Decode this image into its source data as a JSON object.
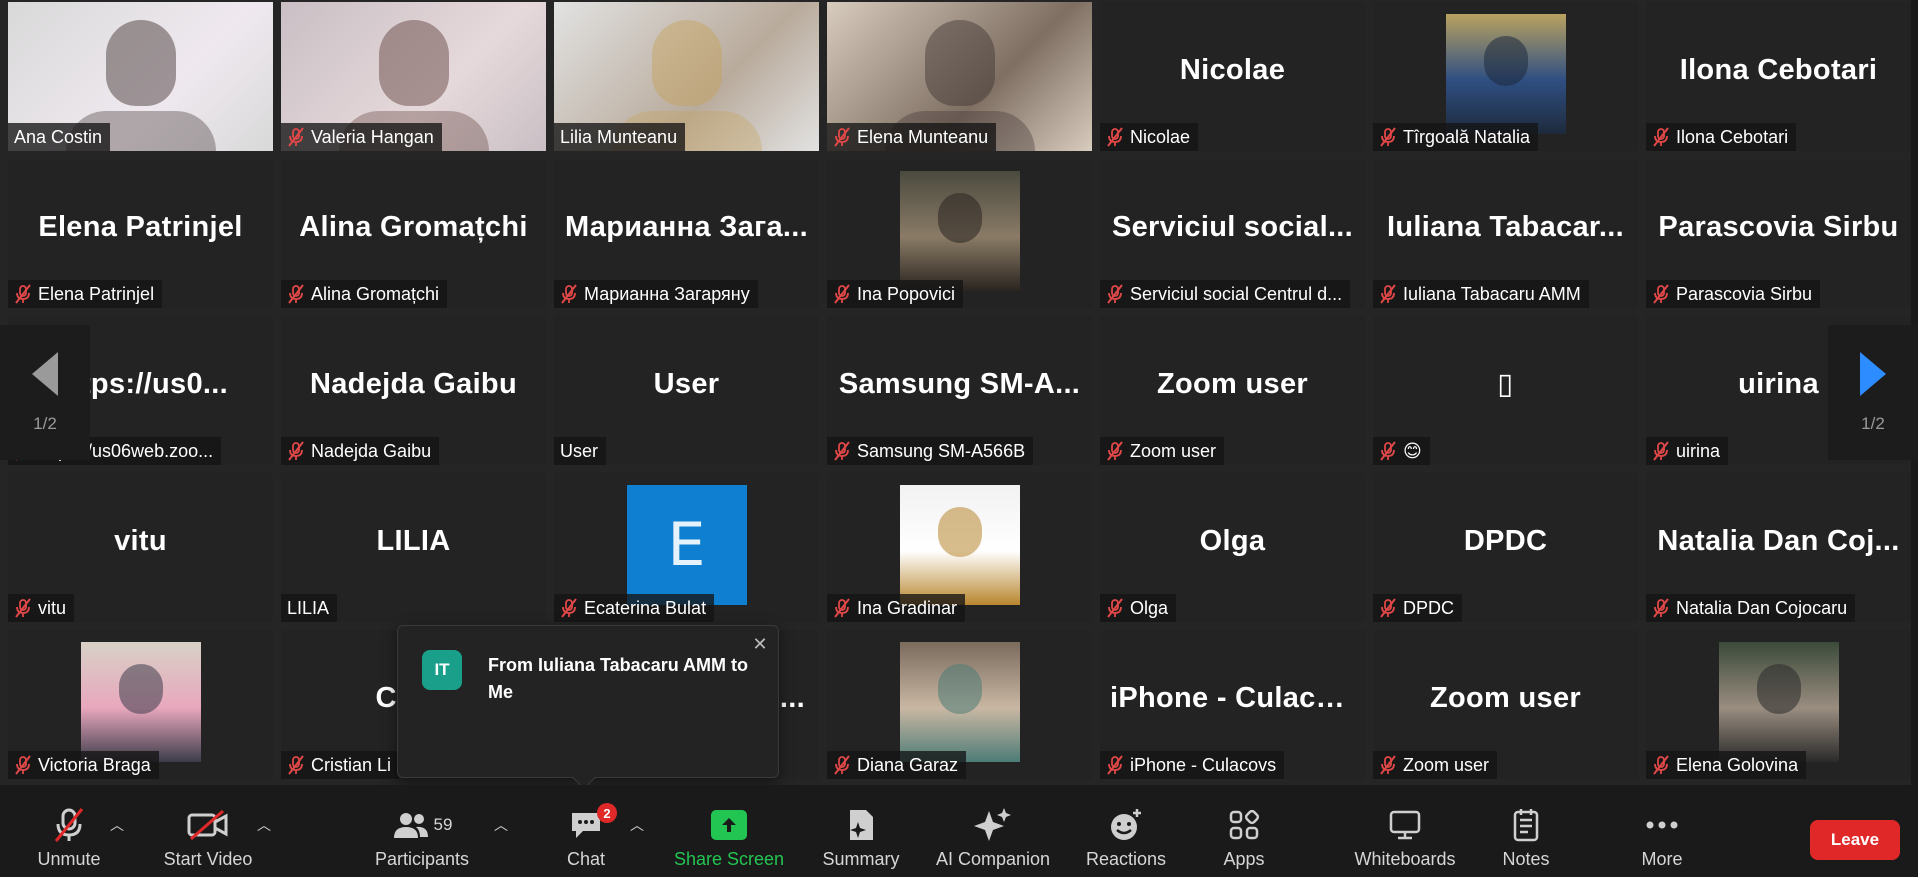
{
  "participants_grid": [
    {
      "name": "Ana Costin",
      "display": "",
      "muted": false,
      "kind": "video",
      "colors": [
        "#d9d9d9",
        "#efe9ef",
        "#3a2b2b"
      ]
    },
    {
      "name": "Valeria Hangan",
      "display": "",
      "muted": true,
      "kind": "video",
      "colors": [
        "#c9bfc4",
        "#e6d9db",
        "#5c3a35"
      ]
    },
    {
      "name": "Lilia Munteanu",
      "display": "",
      "muted": false,
      "kind": "video",
      "active": true,
      "colors": [
        "#e2e2e2",
        "#b9ab9c",
        "#c5a25c"
      ]
    },
    {
      "name": "Elena Munteanu",
      "display": "",
      "muted": true,
      "kind": "video",
      "colors": [
        "#d8ccbe",
        "#7f6f63",
        "#3c3231"
      ]
    },
    {
      "name": "Nicolae",
      "display": "Nicolae",
      "muted": true,
      "kind": "text"
    },
    {
      "name": "Tîrgoală Natalia",
      "display": "",
      "muted": true,
      "kind": "photo",
      "colors": [
        "#b9a260",
        "#2f4f82",
        "#1e2a3c"
      ]
    },
    {
      "name": "Ilona Cebotari",
      "display": "Ilona Cebotari",
      "muted": true,
      "kind": "text"
    },
    {
      "name": "Elena Patrinjel",
      "display": "Elena Patrinjel",
      "muted": true,
      "kind": "text"
    },
    {
      "name": "Alina Gromațchi",
      "display": "Alina Gromațchi",
      "muted": true,
      "kind": "text"
    },
    {
      "name": "Марианна Загаряну",
      "display": "Марианна Зага...",
      "muted": true,
      "kind": "text"
    },
    {
      "name": "Ina Popovici",
      "display": "",
      "muted": true,
      "kind": "photo",
      "colors": [
        "#4b4a3f",
        "#8a7b66",
        "#2a2520"
      ]
    },
    {
      "name": "Serviciul social Centrul d...",
      "display": "Serviciul social...",
      "muted": true,
      "kind": "text"
    },
    {
      "name": "Iuliana Tabacaru AMM",
      "display": "Iuliana Tabacar...",
      "muted": true,
      "kind": "text"
    },
    {
      "name": "Parascovia Sirbu",
      "display": "Parascovia Sirbu",
      "muted": true,
      "kind": "text"
    },
    {
      "name": "https://us06web.zoo...",
      "display": "https://us0...",
      "muted": true,
      "kind": "text"
    },
    {
      "name": "Nadejda Gaibu",
      "display": "Nadejda Gaibu",
      "muted": true,
      "kind": "text"
    },
    {
      "name": "User",
      "display": "User",
      "muted": false,
      "kind": "text"
    },
    {
      "name": "Samsung SM-A566B",
      "display": "Samsung SM-A...",
      "muted": true,
      "kind": "text"
    },
    {
      "name": "Zoom user",
      "display": "Zoom user",
      "muted": true,
      "kind": "text"
    },
    {
      "name": "😊",
      "display": "▯",
      "muted": true,
      "kind": "text"
    },
    {
      "name": "uirina",
      "display": "uirina",
      "muted": true,
      "kind": "text"
    },
    {
      "name": "vitu",
      "display": "vitu",
      "muted": true,
      "kind": "text"
    },
    {
      "name": "LILIA",
      "display": "LILIA",
      "muted": false,
      "kind": "text"
    },
    {
      "name": "Ecaterina Bulat",
      "display": "E",
      "muted": true,
      "kind": "letter"
    },
    {
      "name": "Ina Gradinar",
      "display": "",
      "muted": true,
      "kind": "photo",
      "colors": [
        "#f2f2f2",
        "#ffffff",
        "#b8862e"
      ]
    },
    {
      "name": "Olga",
      "display": "Olga",
      "muted": true,
      "kind": "text"
    },
    {
      "name": "DPDC",
      "display": "DPDC",
      "muted": true,
      "kind": "text"
    },
    {
      "name": "Natalia Dan Cojocaru",
      "display": "Natalia Dan Coj...",
      "muted": true,
      "kind": "text"
    },
    {
      "name": "Victoria Braga",
      "display": "",
      "muted": true,
      "kind": "photo",
      "colors": [
        "#d8d1c7",
        "#e8a7bd",
        "#3c3c4a"
      ]
    },
    {
      "name": "Cristian Li",
      "display": "Cristi",
      "muted": true,
      "kind": "text"
    },
    {
      "name": "",
      "display": "...",
      "muted": false,
      "kind": "hidden"
    },
    {
      "name": "Diana Garaz",
      "display": "",
      "muted": true,
      "kind": "photo",
      "colors": [
        "#7a6b5d",
        "#c9b7a3",
        "#4d7c77"
      ]
    },
    {
      "name": "iPhone - Culacovs",
      "display": "iPhone - Culacovs",
      "muted": true,
      "kind": "text"
    },
    {
      "name": "Zoom user",
      "display": "Zoom user",
      "muted": true,
      "kind": "text"
    },
    {
      "name": "Elena Golovina",
      "display": "",
      "muted": true,
      "kind": "photo",
      "colors": [
        "#3b4a3a",
        "#9a8d80",
        "#2a2a2a"
      ]
    }
  ],
  "pagination": {
    "left": "1/2",
    "right": "1/2"
  },
  "toast": {
    "initials": "IT",
    "message": "From Iuliana Tabacaru AMM to Me"
  },
  "toolbar": {
    "unmute": "Unmute",
    "start_video": "Start Video",
    "participants": "Participants",
    "participants_count": "59",
    "chat": "Chat",
    "chat_badge": "2",
    "share_screen": "Share Screen",
    "summary": "Summary",
    "ai_companion": "AI Companion",
    "reactions": "Reactions",
    "apps": "Apps",
    "whiteboards": "Whiteboards",
    "notes": "Notes",
    "more": "More",
    "leave": "Leave"
  },
  "colors": {
    "accent_green": "#23c552",
    "leave_red": "#e02828",
    "active_border": "#e6e48a",
    "nav_blue": "#2d8cff"
  }
}
